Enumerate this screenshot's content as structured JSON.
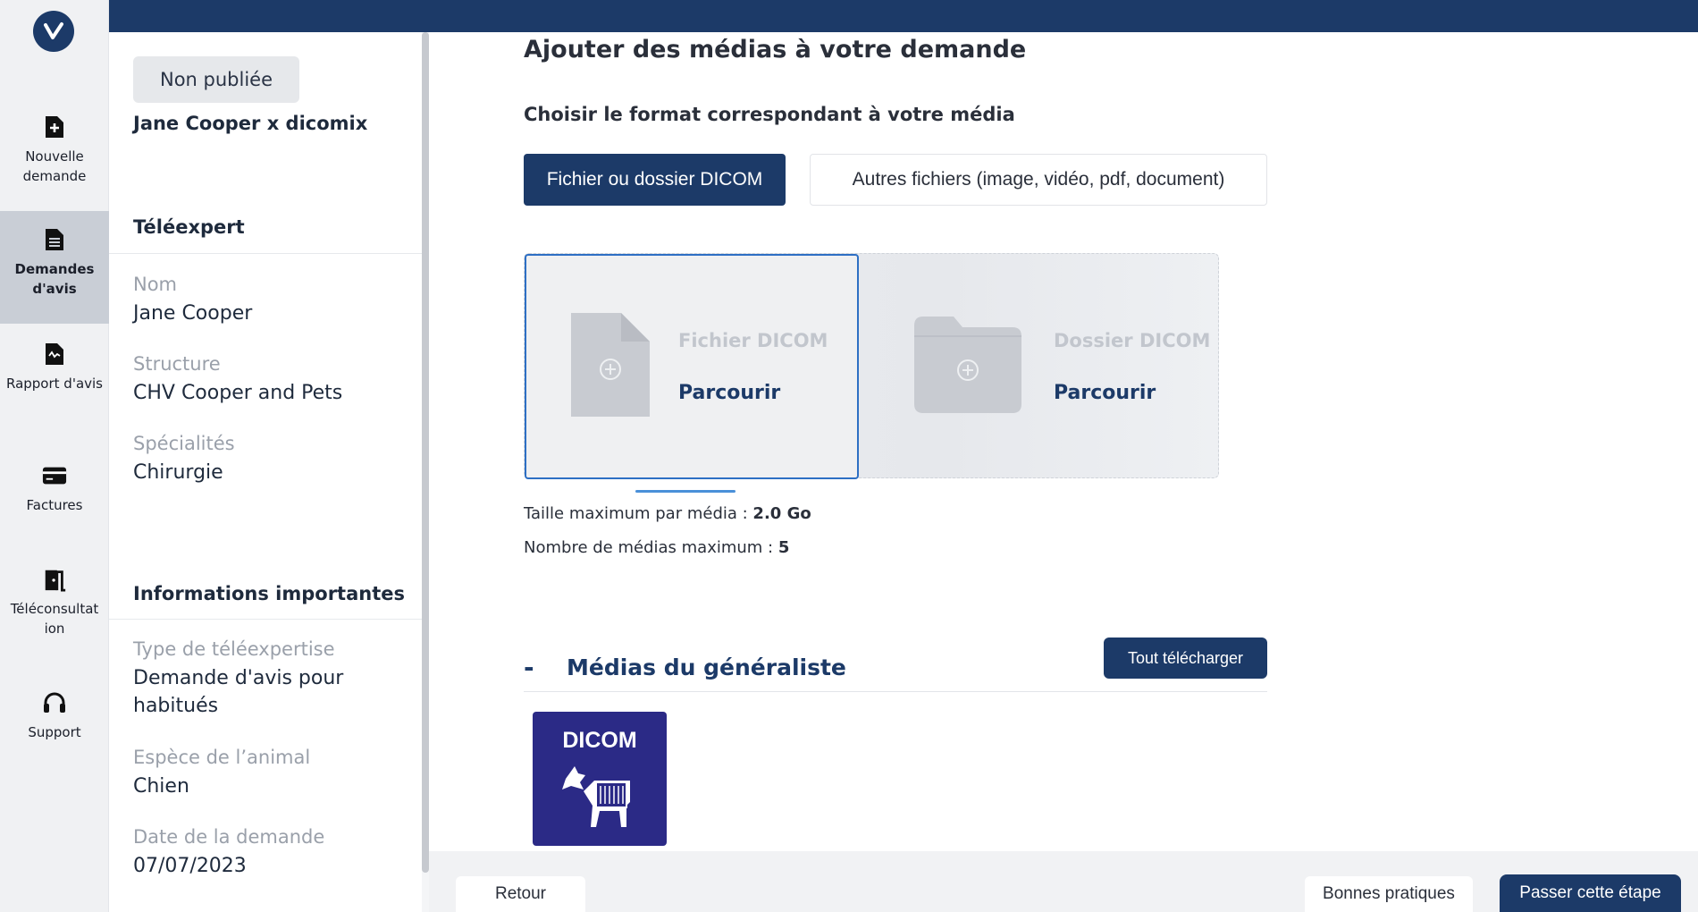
{
  "rail": {
    "logo_letter": "V",
    "items": [
      {
        "label": "Nouvelle demande",
        "icon": "file-plus-icon"
      },
      {
        "label": "Demandes d'avis",
        "icon": "document-icon",
        "active": true
      },
      {
        "label": "Rapport d'avis",
        "icon": "report-icon"
      },
      {
        "label": "Factures",
        "icon": "credit-card-icon"
      },
      {
        "label": "Téléconsultat ion",
        "icon": "door-icon"
      },
      {
        "label": "Support",
        "icon": "headset-icon"
      }
    ]
  },
  "panel": {
    "status": "Non publiée",
    "case_title": "Jane Cooper x dicomix",
    "teleexpert_heading": "Téléexpert",
    "fields": [
      {
        "label": "Nom",
        "value": "Jane Cooper"
      },
      {
        "label": "Structure",
        "value": "CHV Cooper and Pets"
      },
      {
        "label": "Spécialités",
        "value": "Chirurgie"
      }
    ],
    "info_heading": "Informations importantes",
    "info_fields": [
      {
        "label": "Type de téléexpertise",
        "value": "Demande d'avis pour habitués"
      },
      {
        "label": "Espèce de l’animal",
        "value": "Chien"
      },
      {
        "label": "Date de la demande",
        "value": "07/07/2023"
      }
    ]
  },
  "main": {
    "title": "Ajouter des médias à votre demande",
    "subtitle": "Choisir le format correspondant à votre média",
    "format_dicom": "Fichier ou dossier DICOM",
    "format_other": "Autres fichiers (image, vidéo, pdf, document)",
    "drop_file_title": "Fichier DICOM",
    "drop_folder_title": "Dossier DICOM",
    "browse_label": "Parcourir",
    "max_size_label": "Taille maximum par média : ",
    "max_size_value": "2.0 Go",
    "max_count_label": "Nombre de médias maximum : ",
    "max_count_value": "5",
    "section_collapse": "-",
    "section_title": "Médias du généraliste",
    "download_all": "Tout télécharger",
    "tile_label": "DICOM"
  },
  "footer": {
    "back": "Retour",
    "good_practices": "Bonnes pratiques",
    "skip": "Passer cette étape"
  },
  "colors": {
    "primary": "#1c3a68",
    "accent_blue": "#2d6fc4",
    "dicom_tile": "#2b2a86"
  }
}
